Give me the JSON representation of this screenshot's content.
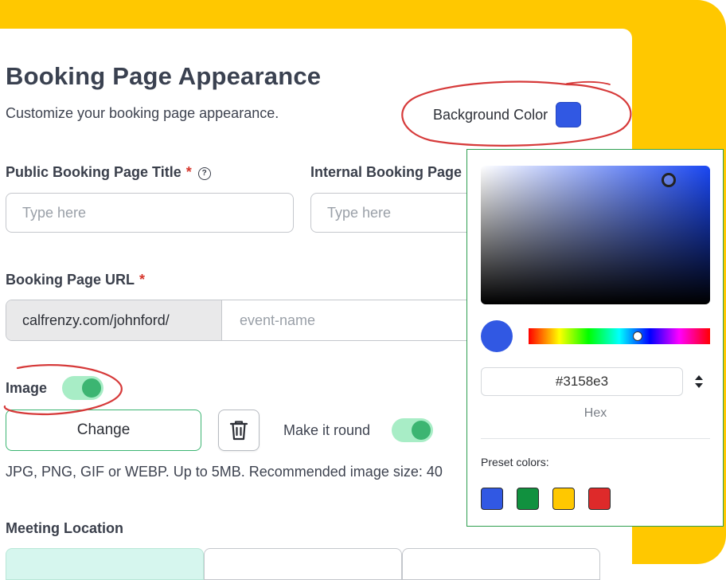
{
  "page": {
    "title": "Booking Page Appearance",
    "subtitle": "Customize your booking page appearance."
  },
  "background_color": {
    "label": "Background Color",
    "value": "#3158e3"
  },
  "fields": {
    "public_title": {
      "label": "Public Booking Page Title",
      "required_mark": "*",
      "help_icon": "?",
      "placeholder": "Type here"
    },
    "internal_title": {
      "label": "Internal Booking Page",
      "placeholder": "Type here"
    },
    "url": {
      "label": "Booking Page URL",
      "required_mark": "*",
      "prefix": "calfrenzy.com/johnford/",
      "placeholder": "event-name"
    }
  },
  "image": {
    "label": "Image",
    "enabled": true,
    "change_label": "Change",
    "trash_icon": "trash-icon",
    "make_round_label": "Make it round",
    "make_round_enabled": true,
    "hint": "JPG, PNG, GIF or WEBP. Up to 5MB. Recommended image size: 40"
  },
  "meeting_location": {
    "label": "Meeting Location"
  },
  "color_picker": {
    "hex_value": "#3158e3",
    "format_label": "Hex",
    "preset_label": "Preset colors:",
    "presets": [
      "#3158e3",
      "#11913f",
      "#ffc800",
      "#de2a2a"
    ],
    "hue_fraction": 0.6
  },
  "colors": {
    "accent_green": "#3cb572",
    "annotation_red": "#d63a3a",
    "frame_yellow": "#ffc800"
  }
}
